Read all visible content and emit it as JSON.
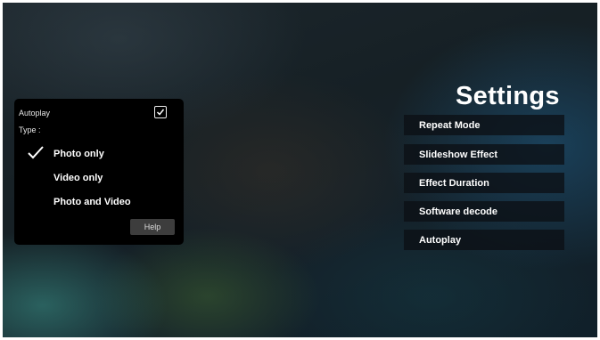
{
  "panel": {
    "autoplay_label": "Autoplay",
    "autoplay_checked": true,
    "type_label": "Type :",
    "options": [
      {
        "label": "Photo only",
        "selected": true
      },
      {
        "label": "Video only",
        "selected": false
      },
      {
        "label": "Photo and Video",
        "selected": false
      }
    ],
    "help_label": "Help"
  },
  "settings": {
    "title": "Settings",
    "items": [
      {
        "label": "Repeat Mode"
      },
      {
        "label": "Slideshow Effect"
      },
      {
        "label": "Effect Duration"
      },
      {
        "label": "Software decode"
      },
      {
        "label": "Autoplay"
      }
    ]
  }
}
